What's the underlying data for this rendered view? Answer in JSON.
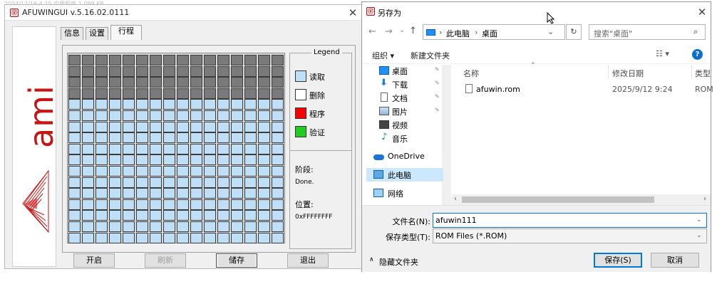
{
  "background_desktop_text": "2024/12/16  4:15       应用程序          1,099 KB",
  "afu": {
    "title": "AFUWINGUI v.5.16.02.0111",
    "logo_text": "ami",
    "tabs": [
      "信息",
      "设置",
      "行程"
    ],
    "active_tab": 2,
    "grid": {
      "rows": 17,
      "cols": 16,
      "done_rows": 4,
      "done_color": "#7a7a7a",
      "read_color": "#bfdff6"
    },
    "legend": {
      "title": "Legend",
      "items": [
        {
          "label": "读取",
          "color": "#bfdff6"
        },
        {
          "label": "删除",
          "color": "#ffffff"
        },
        {
          "label": "程序",
          "color": "#ff0000"
        },
        {
          "label": "验证",
          "color": "#22cc22"
        }
      ]
    },
    "status": {
      "stage_label": "阶段:",
      "stage_value": "Done.",
      "pos_label": "位置:",
      "pos_value": "0xFFFFFFFF"
    },
    "buttons": {
      "start": "开启",
      "flash": "刷新",
      "save": "储存",
      "exit": "退出"
    }
  },
  "save_dialog": {
    "title": "另存为",
    "breadcrumb": [
      "此电脑",
      "桌面"
    ],
    "search_placeholder": "搜索\"桌面\"",
    "toolbar": {
      "organize": "组织 ▾",
      "new_folder": "新建文件夹"
    },
    "nav": [
      {
        "label": "桌面",
        "icon": "desktop-icon",
        "pinned": true
      },
      {
        "label": "下载",
        "icon": "download-icon",
        "pinned": true
      },
      {
        "label": "文档",
        "icon": "document-icon",
        "pinned": true
      },
      {
        "label": "图片",
        "icon": "picture-icon",
        "pinned": true
      },
      {
        "label": "视频",
        "icon": "video-icon",
        "pinned": false
      },
      {
        "label": "音乐",
        "icon": "music-icon",
        "pinned": false
      },
      {
        "label": "OneDrive",
        "icon": "cloud-icon",
        "pinned": false
      },
      {
        "label": "此电脑",
        "icon": "computer-icon",
        "pinned": false,
        "selected": true
      },
      {
        "label": "网络",
        "icon": "network-icon",
        "pinned": false
      }
    ],
    "columns": {
      "name": "名称",
      "modified": "修改日期",
      "type": "类型"
    },
    "files": [
      {
        "name": "afuwin.rom",
        "modified": "2025/9/12 9:24",
        "type": "ROM"
      }
    ],
    "filename_label": "文件名(N):",
    "filename_value": "afuwin111",
    "filetype_label": "保存类型(T):",
    "filetype_value": "ROM Files (*.ROM)",
    "hide_folders": "隐藏文件夹",
    "save_btn": "保存(S)",
    "cancel_btn": "取消",
    "accent_color": "#0078d7"
  }
}
